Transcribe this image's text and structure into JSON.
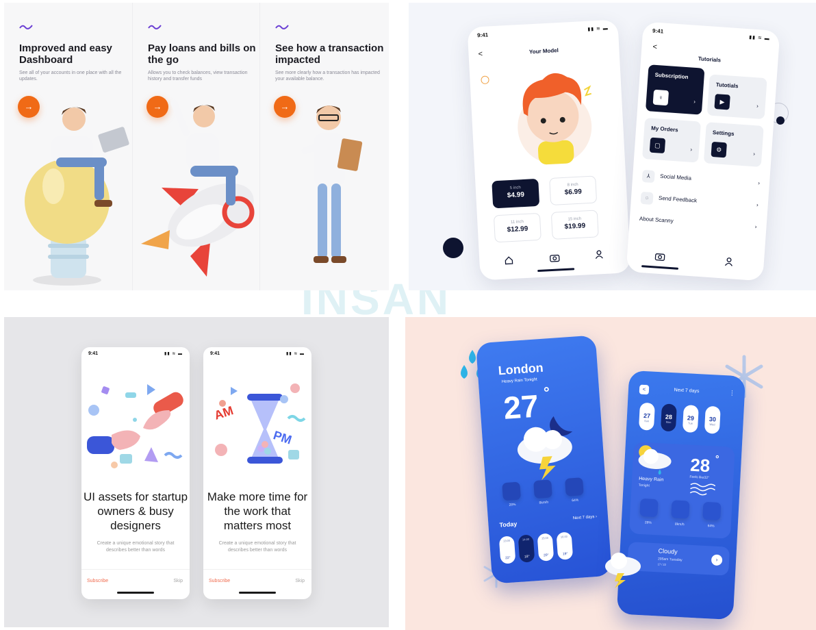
{
  "watermark": "INSAN",
  "onboarding": {
    "panels": [
      {
        "title": "Improved and easy Dashboard",
        "desc": "See all of your accounts in one place with all the updates.",
        "btn": "→"
      },
      {
        "title": "Pay loans and bills on the go",
        "desc": "Allows you to check balances, view transaction history and transfer funds",
        "btn": "→"
      },
      {
        "title": "See how a transaction impacted",
        "desc": "See more clearly how a transaction has impacted your available balance.",
        "btn": "→"
      }
    ],
    "accent": "#f06a16"
  },
  "model_app": {
    "status_time": "9:41",
    "status_icons": "▮▮ ≋ ▬",
    "back": "<",
    "title": "Your Model",
    "prices": [
      {
        "size": "5 inch",
        "price": "$4.99",
        "active": true
      },
      {
        "size": "8 inch",
        "price": "$6.99",
        "active": false
      },
      {
        "size": "11 inch",
        "price": "$12.99",
        "active": false
      },
      {
        "size": "15 inch",
        "price": "$19.99",
        "active": false
      }
    ],
    "nav_icons": [
      "home-icon",
      "camera-icon",
      "user-icon"
    ]
  },
  "tutorials_app": {
    "status_time": "9:41",
    "status_icons": "▮▮ ≋ ▬",
    "back": "<",
    "title": "Tutorials",
    "cards": [
      {
        "label": "Subscription",
        "icon": "♀",
        "arrow": "›"
      },
      {
        "label": "Tutotials",
        "icon": "▶",
        "arrow": "›"
      },
      {
        "label": "My Orders",
        "icon": "▢",
        "arrow": "›"
      },
      {
        "label": "Settings",
        "icon": "⚙",
        "arrow": "›"
      }
    ],
    "rows": [
      {
        "label": "Social Media",
        "icon": "⅄",
        "chev": "›"
      },
      {
        "label": "Send Feedback",
        "icon": "◌",
        "chev": "›"
      },
      {
        "label": "About Scanny",
        "icon": "",
        "chev": "›"
      }
    ]
  },
  "assets_app": [
    {
      "status_time": "9:41",
      "status_icons": "▮▮ ≋ ▬",
      "title": "UI assets for startup owners & busy designers",
      "desc": "Create a unique emotional story that describes better than words",
      "subscribe": "Subscribe",
      "skip": "Skip"
    },
    {
      "status_time": "9:41",
      "status_icons": "▮▮ ≋ ▬",
      "title": "Make more time for the work that matters most",
      "desc": "Create a unique emotional story that describes better than words",
      "subscribe": "Subscribe",
      "skip": "Skip",
      "art_am": "AM",
      "art_pm": "PM"
    }
  ],
  "weather_main": {
    "city": "London",
    "subtitle": "Heavy Rain Tonight",
    "temp": "27",
    "degree": "°",
    "stats": [
      "28%",
      "8km/h",
      "64%"
    ],
    "today": "Today",
    "next": "Next 7 days  ›",
    "hours": [
      "13:00",
      "14:00",
      "15:00",
      "16:00"
    ],
    "hour_temps": [
      "22°",
      "18°",
      "20°",
      "19°"
    ]
  },
  "weather_week": {
    "back": "<",
    "title": "Next 7 days",
    "menu": "⋮",
    "days": [
      {
        "num": "27",
        "day": "Sun",
        "active": false
      },
      {
        "num": "28",
        "day": "Mon",
        "active": true
      },
      {
        "num": "29",
        "day": "Tue",
        "active": false
      },
      {
        "num": "30",
        "day": "Wed",
        "active": false
      }
    ],
    "temp": "28",
    "degree": "°",
    "feels": "Feels like32°",
    "condition": "Heavy Rain",
    "when": "Tonight",
    "stats": [
      "28%",
      "8km/h",
      "64%"
    ],
    "cloudy": "Cloudy",
    "cloudy_sub": "295am Tuesday",
    "cloudy_pager": "17 / 22"
  }
}
